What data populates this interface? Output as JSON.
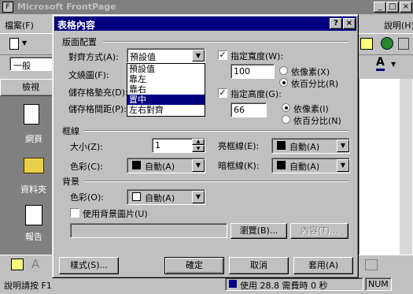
{
  "app": {
    "title": "Microsoft FrontPage",
    "menu": [
      "檔案(F)",
      "說明(H)"
    ],
    "style_combo": "一般",
    "views_title": "檢視",
    "views": [
      "網頁",
      "資料夾",
      "報告"
    ],
    "status_left": "說明請按 F1",
    "status_right": "使用 28.8 需費時 0 秒",
    "status_num": "NUM"
  },
  "dialog": {
    "title": "表格內容",
    "help_btn": "?",
    "close_btn": "×",
    "layout_group": "版面配置",
    "align_label": "對齊方式(A):",
    "align_value": "預設值",
    "align_options": [
      "預設值",
      "靠左",
      "靠右",
      "置中",
      "左右對齊"
    ],
    "align_selected_index": 3,
    "wrap_label": "文繞圖(F):",
    "padding_label": "儲存格墊充(D):",
    "spacing_label": "儲存格間距(P):",
    "width_check": "指定寬度(W):",
    "width_checked": true,
    "width_value": "100",
    "width_px": "依像素(X)",
    "width_pct": "依百分比(R)",
    "width_unit": "percent",
    "height_check": "指定高度(G):",
    "height_checked": true,
    "height_value": "66",
    "height_px": "依像素(I)",
    "height_pct": "依百分比(N)",
    "height_unit": "pixels",
    "border_group": "框線",
    "size_label": "大小(Z):",
    "size_value": "1",
    "color_label": "色彩(C):",
    "light_label": "亮框線(E):",
    "dark_label": "暗框線(K):",
    "auto_label": "自動(A)",
    "bg_group": "背景",
    "bg_color_label": "色彩(O):",
    "bg_image_check": "使用背景圖片(U)",
    "browse_btn": "瀏覽(B)...",
    "props_btn": "內容(T)...",
    "style_btn": "樣式(S)...",
    "ok_btn": "確定",
    "cancel_btn": "取消",
    "apply_btn": "套用(A)",
    "colors": {
      "auto_swatch": "#000000",
      "bg_swatch": "#ffffff",
      "title_bar": "#000080"
    }
  }
}
